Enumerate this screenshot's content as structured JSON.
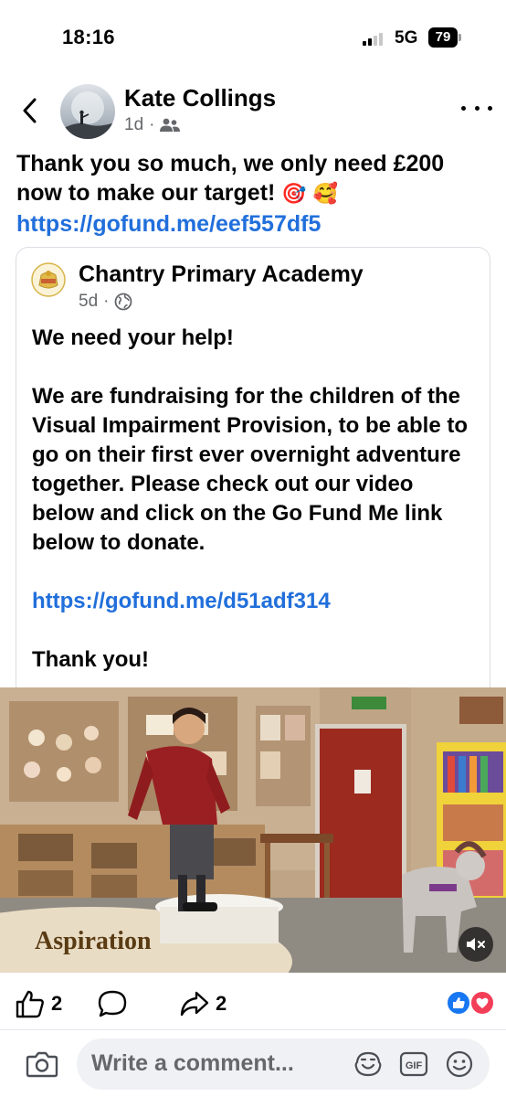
{
  "status_bar": {
    "time": "18:16",
    "network": "5G",
    "battery": "79"
  },
  "post": {
    "author": "Kate Collings",
    "age": "1d",
    "audience_icon": "friends-icon",
    "text_main": "Thank you so much, we only need £200 now to make our target!",
    "emojis": [
      "🎯",
      "🥰"
    ],
    "link": "https://gofund.me/eef557df5"
  },
  "shared": {
    "page_name": "Chantry Primary Academy",
    "age": "5d",
    "audience_icon": "globe-icon",
    "line1": "We need your help!",
    "line2": "We are fundraising for the children of the Visual Impairment Provision, to be able to go on their first ever overnight adventure together. Please check out our video below and click on the Go Fund Me link below to donate.",
    "link": "https://gofund.me/d51adf314",
    "line3": "Thank you!"
  },
  "video": {
    "caption": "Aspiration",
    "muted": true
  },
  "actions": {
    "likes": "2",
    "shares": "2"
  },
  "comment": {
    "placeholder": "Write a comment..."
  },
  "colors": {
    "link": "#216fdb",
    "like_blue": "#1877f2",
    "love_red": "#f33e58"
  }
}
